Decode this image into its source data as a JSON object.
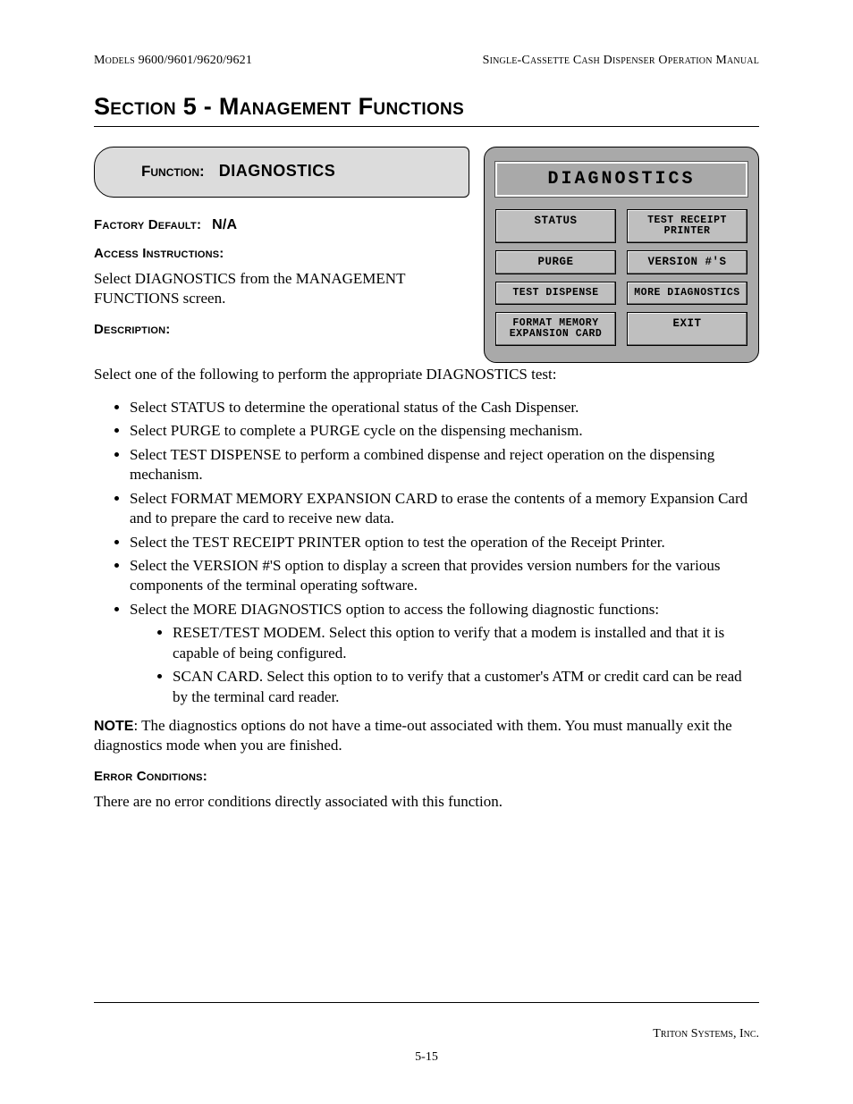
{
  "header": {
    "left": "Models 9600/9601/9620/9621",
    "right": "Single-Cassette Cash Dispenser Operation Manual"
  },
  "section_title": "Section 5 - Management Functions",
  "function": {
    "label": "Function:",
    "value": "DIAGNOSTICS"
  },
  "factory_default": {
    "label": "Factory Default:",
    "value": "N/A"
  },
  "access_instructions": {
    "label": "Access Instructions:",
    "text": "Select DIAGNOSTICS from the MANAGEMENT FUNCTIONS screen."
  },
  "description": {
    "label": "Description:",
    "intro": "Select one of the following to perform the appropriate DIAGNOSTICS test:",
    "bullets": [
      "Select STATUS to determine the operational status of the Cash Dispenser.",
      "Select PURGE to complete a PURGE cycle on the dispensing mechanism.",
      "Select TEST DISPENSE to perform a combined dispense and reject operation on the dispensing mechanism.",
      "Select FORMAT MEMORY EXPANSION CARD to erase the contents of a memory Expansion Card and to prepare the card to receive new data.",
      "Select the TEST RECEIPT PRINTER option to test the operation of the Receipt Printer.",
      "Select the VERSION #'S option to display a screen that provides version numbers for the various components of the terminal operating software.",
      "Select the MORE DIAGNOSTICS option to access the following diagnostic functions:"
    ],
    "sub_bullets": [
      "RESET/TEST MODEM. Select this option to verify that a modem is installed and that it is capable of being configured.",
      "SCAN CARD. Select this option to to verify that a customer's ATM or credit card can be read by the terminal card reader."
    ]
  },
  "note": {
    "label": "NOTE",
    "text": ": The diagnostics options do not have a time-out associated with them.  You must manually exit the diagnostics mode when you are finished."
  },
  "error_conditions": {
    "label": "Error Conditions:",
    "text": "There are no error conditions directly associated with this function."
  },
  "device": {
    "title": "DIAGNOSTICS",
    "buttons": [
      "STATUS",
      "TEST RECEIPT PRINTER",
      "PURGE",
      "VERSION #'S",
      "TEST DISPENSE",
      "MORE DIAGNOSTICS",
      "FORMAT MEMORY EXPANSION CARD",
      "EXIT"
    ]
  },
  "footer": {
    "company": "Triton Systems, Inc.",
    "page": "5-15"
  }
}
